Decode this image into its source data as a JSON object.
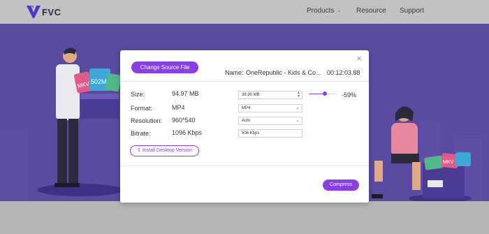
{
  "header": {
    "logo_text": "FVC",
    "nav": {
      "products": "Products",
      "resource": "Resource",
      "support": "Support"
    }
  },
  "modal": {
    "change_source_label": "Change Source File",
    "name_label": "Name:",
    "file_name": "OneRepublic - Kids & Co...",
    "duration": "00:12:03.88",
    "size_label": "Size:",
    "size_value": "94.97 MB",
    "size_target": "38.90  MB",
    "size_change": "-59%",
    "size_ratio": 0.41,
    "format_label": "Format:",
    "format_value": "MP4",
    "format_selected": "MP4",
    "resolution_label": "Resolution:",
    "resolution_value": "960*540",
    "resolution_selected": "Auto",
    "bitrate_label": "Bitrate:",
    "bitrate_value": "1096 Kbps",
    "bitrate_target": "506 Kbps",
    "install_label": "Install Desktop Version",
    "compress_label": "Compress"
  },
  "colors": {
    "accent": "#8a3fe0",
    "hero": "#5a4aa0"
  }
}
